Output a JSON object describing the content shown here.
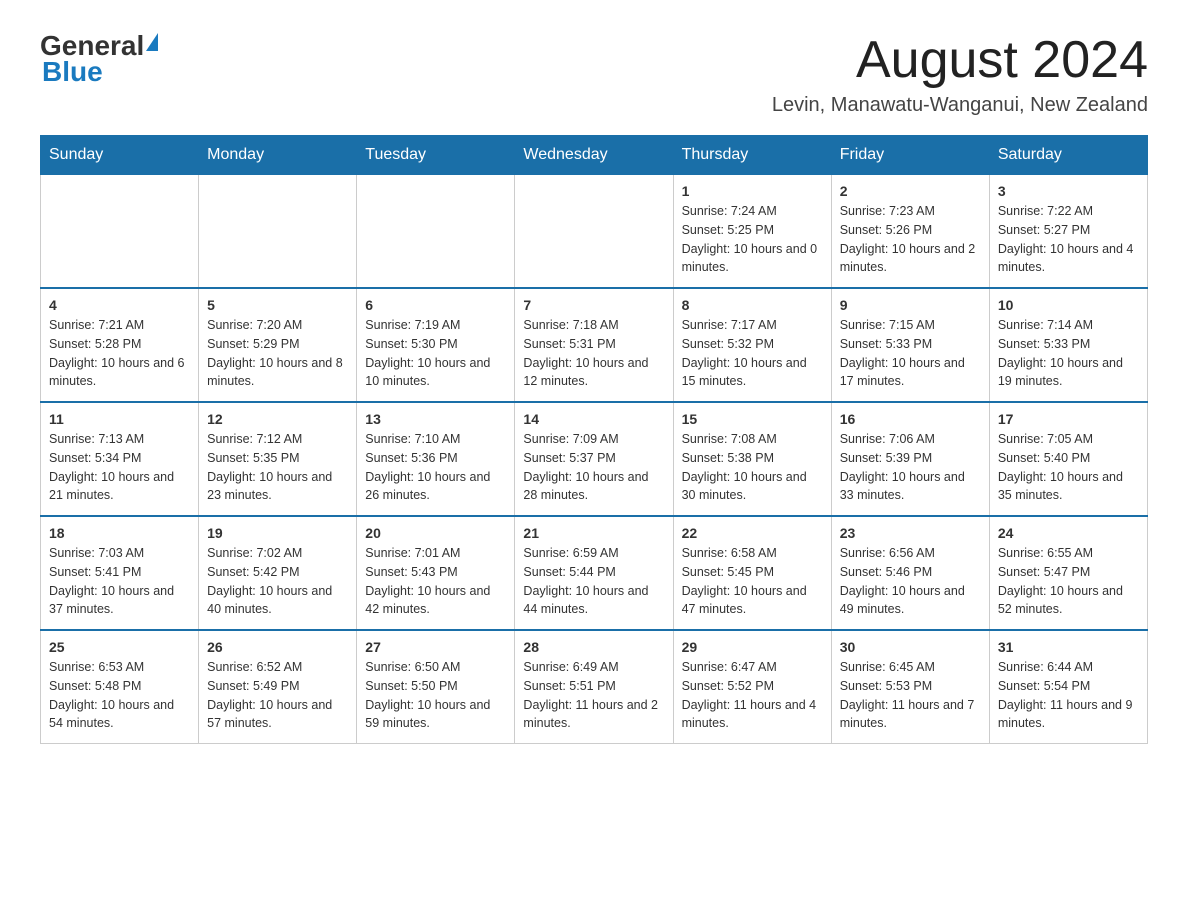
{
  "header": {
    "logo_general": "General",
    "logo_blue": "Blue",
    "title": "August 2024",
    "subtitle": "Levin, Manawatu-Wanganui, New Zealand"
  },
  "weekdays": [
    "Sunday",
    "Monday",
    "Tuesday",
    "Wednesday",
    "Thursday",
    "Friday",
    "Saturday"
  ],
  "weeks": [
    [
      {
        "day": "",
        "info": ""
      },
      {
        "day": "",
        "info": ""
      },
      {
        "day": "",
        "info": ""
      },
      {
        "day": "",
        "info": ""
      },
      {
        "day": "1",
        "info": "Sunrise: 7:24 AM\nSunset: 5:25 PM\nDaylight: 10 hours and 0 minutes."
      },
      {
        "day": "2",
        "info": "Sunrise: 7:23 AM\nSunset: 5:26 PM\nDaylight: 10 hours and 2 minutes."
      },
      {
        "day": "3",
        "info": "Sunrise: 7:22 AM\nSunset: 5:27 PM\nDaylight: 10 hours and 4 minutes."
      }
    ],
    [
      {
        "day": "4",
        "info": "Sunrise: 7:21 AM\nSunset: 5:28 PM\nDaylight: 10 hours and 6 minutes."
      },
      {
        "day": "5",
        "info": "Sunrise: 7:20 AM\nSunset: 5:29 PM\nDaylight: 10 hours and 8 minutes."
      },
      {
        "day": "6",
        "info": "Sunrise: 7:19 AM\nSunset: 5:30 PM\nDaylight: 10 hours and 10 minutes."
      },
      {
        "day": "7",
        "info": "Sunrise: 7:18 AM\nSunset: 5:31 PM\nDaylight: 10 hours and 12 minutes."
      },
      {
        "day": "8",
        "info": "Sunrise: 7:17 AM\nSunset: 5:32 PM\nDaylight: 10 hours and 15 minutes."
      },
      {
        "day": "9",
        "info": "Sunrise: 7:15 AM\nSunset: 5:33 PM\nDaylight: 10 hours and 17 minutes."
      },
      {
        "day": "10",
        "info": "Sunrise: 7:14 AM\nSunset: 5:33 PM\nDaylight: 10 hours and 19 minutes."
      }
    ],
    [
      {
        "day": "11",
        "info": "Sunrise: 7:13 AM\nSunset: 5:34 PM\nDaylight: 10 hours and 21 minutes."
      },
      {
        "day": "12",
        "info": "Sunrise: 7:12 AM\nSunset: 5:35 PM\nDaylight: 10 hours and 23 minutes."
      },
      {
        "day": "13",
        "info": "Sunrise: 7:10 AM\nSunset: 5:36 PM\nDaylight: 10 hours and 26 minutes."
      },
      {
        "day": "14",
        "info": "Sunrise: 7:09 AM\nSunset: 5:37 PM\nDaylight: 10 hours and 28 minutes."
      },
      {
        "day": "15",
        "info": "Sunrise: 7:08 AM\nSunset: 5:38 PM\nDaylight: 10 hours and 30 minutes."
      },
      {
        "day": "16",
        "info": "Sunrise: 7:06 AM\nSunset: 5:39 PM\nDaylight: 10 hours and 33 minutes."
      },
      {
        "day": "17",
        "info": "Sunrise: 7:05 AM\nSunset: 5:40 PM\nDaylight: 10 hours and 35 minutes."
      }
    ],
    [
      {
        "day": "18",
        "info": "Sunrise: 7:03 AM\nSunset: 5:41 PM\nDaylight: 10 hours and 37 minutes."
      },
      {
        "day": "19",
        "info": "Sunrise: 7:02 AM\nSunset: 5:42 PM\nDaylight: 10 hours and 40 minutes."
      },
      {
        "day": "20",
        "info": "Sunrise: 7:01 AM\nSunset: 5:43 PM\nDaylight: 10 hours and 42 minutes."
      },
      {
        "day": "21",
        "info": "Sunrise: 6:59 AM\nSunset: 5:44 PM\nDaylight: 10 hours and 44 minutes."
      },
      {
        "day": "22",
        "info": "Sunrise: 6:58 AM\nSunset: 5:45 PM\nDaylight: 10 hours and 47 minutes."
      },
      {
        "day": "23",
        "info": "Sunrise: 6:56 AM\nSunset: 5:46 PM\nDaylight: 10 hours and 49 minutes."
      },
      {
        "day": "24",
        "info": "Sunrise: 6:55 AM\nSunset: 5:47 PM\nDaylight: 10 hours and 52 minutes."
      }
    ],
    [
      {
        "day": "25",
        "info": "Sunrise: 6:53 AM\nSunset: 5:48 PM\nDaylight: 10 hours and 54 minutes."
      },
      {
        "day": "26",
        "info": "Sunrise: 6:52 AM\nSunset: 5:49 PM\nDaylight: 10 hours and 57 minutes."
      },
      {
        "day": "27",
        "info": "Sunrise: 6:50 AM\nSunset: 5:50 PM\nDaylight: 10 hours and 59 minutes."
      },
      {
        "day": "28",
        "info": "Sunrise: 6:49 AM\nSunset: 5:51 PM\nDaylight: 11 hours and 2 minutes."
      },
      {
        "day": "29",
        "info": "Sunrise: 6:47 AM\nSunset: 5:52 PM\nDaylight: 11 hours and 4 minutes."
      },
      {
        "day": "30",
        "info": "Sunrise: 6:45 AM\nSunset: 5:53 PM\nDaylight: 11 hours and 7 minutes."
      },
      {
        "day": "31",
        "info": "Sunrise: 6:44 AM\nSunset: 5:54 PM\nDaylight: 11 hours and 9 minutes."
      }
    ]
  ]
}
